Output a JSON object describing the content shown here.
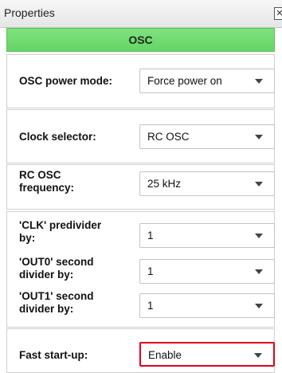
{
  "window": {
    "title": "Properties",
    "close_glyph": "✕"
  },
  "section": {
    "title": "OSC"
  },
  "fields": {
    "osc_power_mode": {
      "label": "OSC power mode:",
      "value": "Force power on"
    },
    "clock_selector": {
      "label": "Clock selector:",
      "value": "RC OSC"
    },
    "rc_osc_frequency": {
      "label_line1": "RC OSC",
      "label_line2": "frequency:",
      "value": "25 kHz"
    },
    "clk_predivider": {
      "label_line1": "'CLK' predivider",
      "label_line2": "by:",
      "value": "1"
    },
    "out0_divider": {
      "label_line1": "'OUT0' second",
      "label_line2": "divider by:",
      "value": "1"
    },
    "out1_divider": {
      "label_line1": "'OUT1' second",
      "label_line2": "divider by:",
      "value": "1"
    },
    "fast_startup": {
      "label": "Fast start-up:",
      "value": "Enable"
    }
  },
  "colors": {
    "header_green": "#66d466",
    "highlight_red": "#e0001b"
  },
  "icons": {
    "dropdown": "chevron-down-icon",
    "close": "close-icon"
  }
}
